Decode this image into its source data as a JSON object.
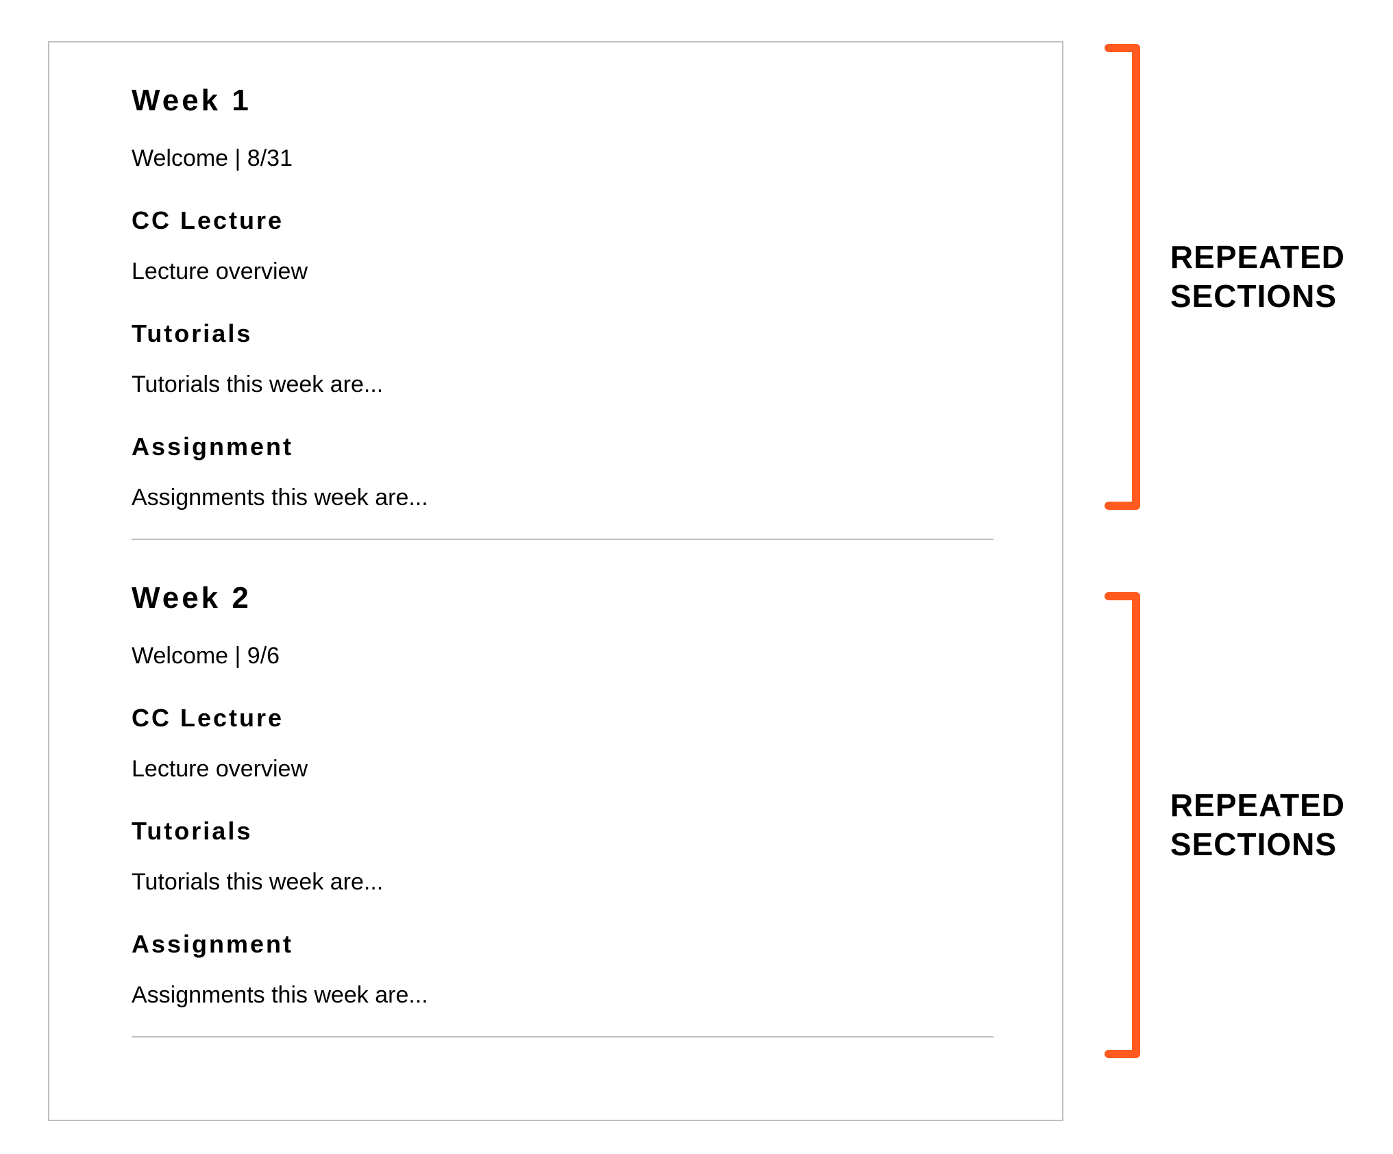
{
  "weeks": [
    {
      "title": "Week 1",
      "welcome": "Welcome | 8/31",
      "sections": [
        {
          "heading": "CC Lecture",
          "body": "Lecture overview"
        },
        {
          "heading": "Tutorials",
          "body": "Tutorials this week are..."
        },
        {
          "heading": "Assignment",
          "body": "Assignments this week are..."
        }
      ]
    },
    {
      "title": "Week 2",
      "welcome": "Welcome | 9/6",
      "sections": [
        {
          "heading": "CC Lecture",
          "body": "Lecture overview"
        },
        {
          "heading": "Tutorials",
          "body": "Tutorials this week are..."
        },
        {
          "heading": "Assignment",
          "body": "Assignments this week are..."
        }
      ]
    }
  ],
  "annotation": {
    "line1": "REPEATED",
    "line2": "SECTIONS",
    "color": "#ff5a1f"
  }
}
